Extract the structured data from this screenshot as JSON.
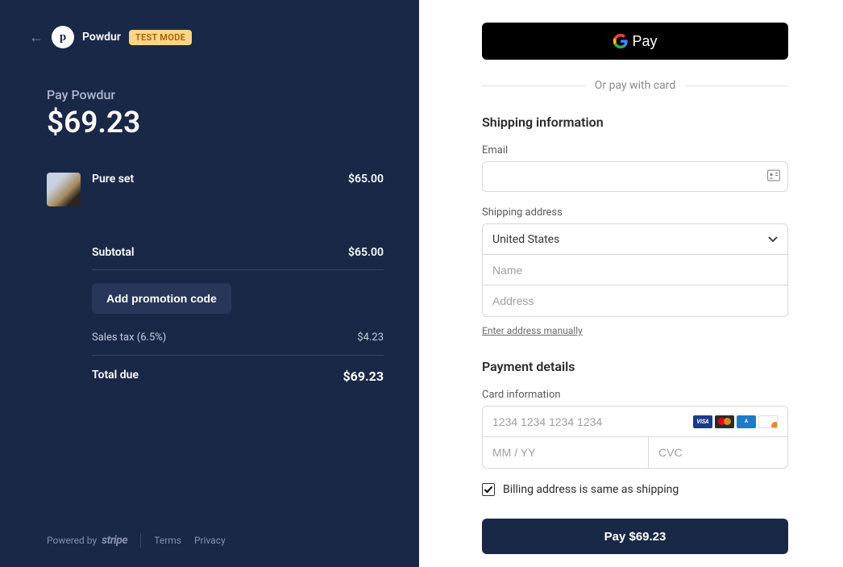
{
  "header": {
    "merchant_name": "Powdur",
    "logo_letter": "p",
    "test_mode_badge": "TEST MODE"
  },
  "summary": {
    "pay_heading": "Pay Powdur",
    "pay_amount": "$69.23",
    "product_name": "Pure set",
    "product_price": "$65.00",
    "subtotal_label": "Subtotal",
    "subtotal_value": "$65.00",
    "promo_button": "Add promotion code",
    "tax_label": "Sales tax (6.5%)",
    "tax_value": "$4.23",
    "total_label": "Total due",
    "total_value": "$69.23"
  },
  "footer": {
    "powered_by": "Powered by",
    "stripe": "stripe",
    "terms": "Terms",
    "privacy": "Privacy"
  },
  "right": {
    "gpay_label": "Pay",
    "or_divider": "Or pay with card",
    "shipping_title": "Shipping information",
    "email_label": "Email",
    "shipping_address_label": "Shipping address",
    "country_value": "United States",
    "name_placeholder": "Name",
    "address_placeholder": "Address",
    "manual_link": "Enter address manually",
    "payment_title": "Payment details",
    "card_info_label": "Card information",
    "card_number_placeholder": "1234 1234 1234 1234",
    "expiry_placeholder": "MM / YY",
    "cvc_placeholder": "CVC",
    "billing_same_label": "Billing address is same as shipping",
    "pay_button": "Pay $69.23"
  }
}
